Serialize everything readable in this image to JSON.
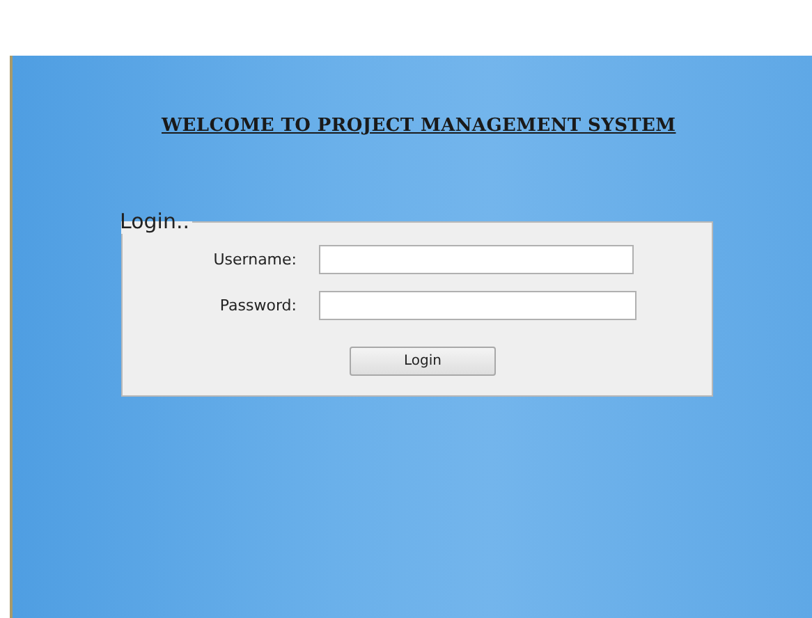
{
  "title": "WELCOME TO PROJECT MANAGEMENT SYSTEM",
  "login_group": {
    "legend": "Login..",
    "fields": [
      {
        "label": "Username:"
      },
      {
        "label": "Password:"
      }
    ],
    "button": "Login"
  }
}
